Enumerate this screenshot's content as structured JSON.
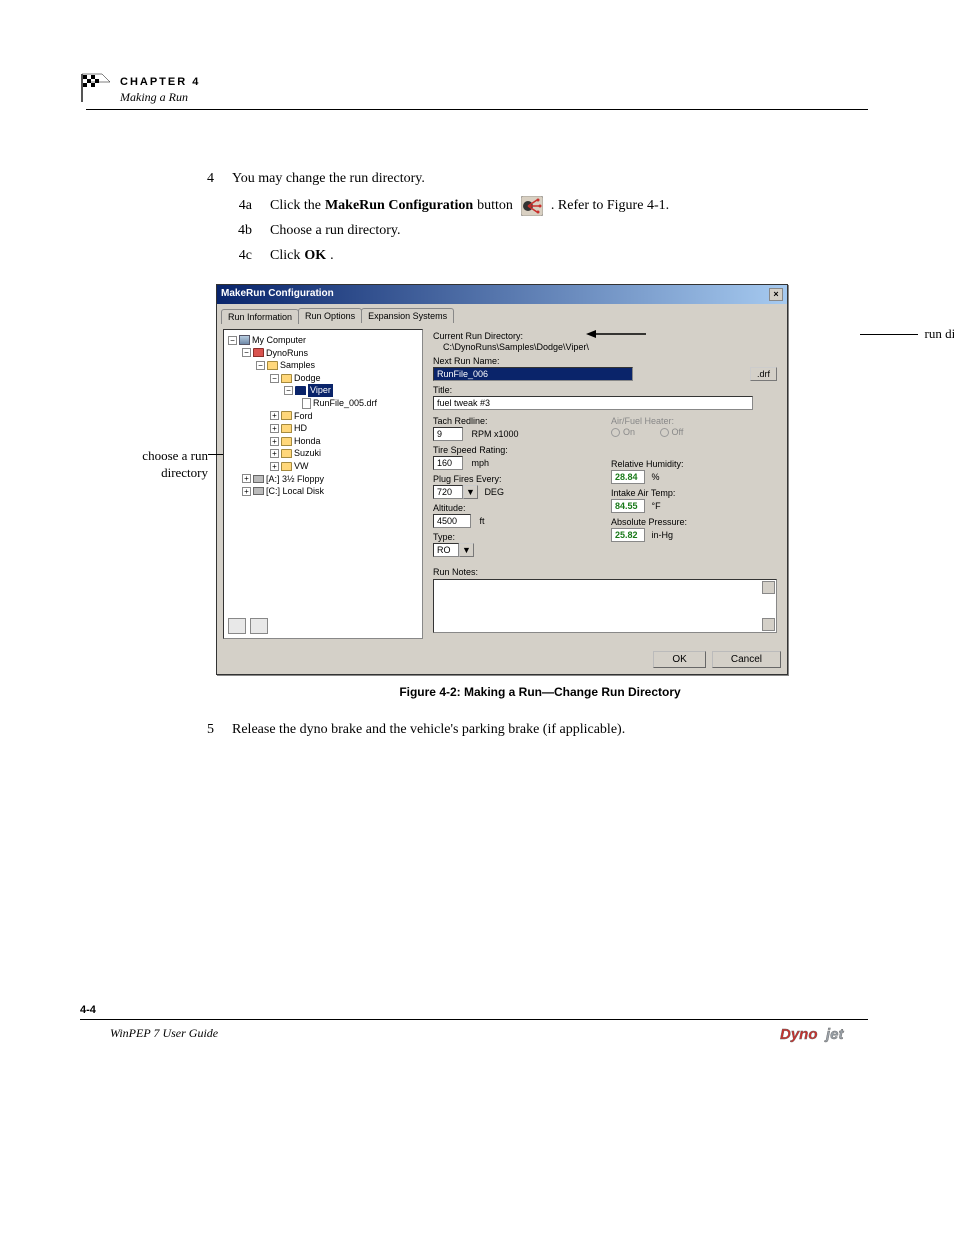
{
  "header": {
    "chapter": "CHAPTER 4",
    "subtitle": "Making a Run"
  },
  "steps": {
    "s4": {
      "num": "4",
      "text": "You may change the run directory."
    },
    "s4a": {
      "num": "4a",
      "pre": "Click the ",
      "bold": "MakeRun Configuration",
      "mid": " button ",
      "post": ". Refer to Figure 4-1."
    },
    "s4b": {
      "num": "4b",
      "text": "Choose a run directory."
    },
    "s4c": {
      "num": "4c",
      "pre": "Click ",
      "bold": "OK",
      "post": "."
    },
    "s5": {
      "num": "5",
      "text": "Release the dyno brake and the vehicle's parking brake (if applicable)."
    }
  },
  "callouts": {
    "left": "choose a run directory",
    "right": "run directory"
  },
  "dialog": {
    "title": "MakeRun Configuration",
    "tabs": {
      "t1": "Run Information",
      "t2": "Run Options",
      "t3": "Expansion Systems"
    },
    "tree": {
      "mycomputer": "My Computer",
      "dynoruns": "DynoRuns",
      "samples": "Samples",
      "dodge": "Dodge",
      "viper": "Viper",
      "runfile": "RunFile_005.drf",
      "ford": "Ford",
      "hd": "HD",
      "honda": "Honda",
      "suzuki": "Suzuki",
      "vw": "VW",
      "floppy": "[A:]  3½ Floppy",
      "localdisk": "[C:]  Local Disk"
    },
    "form": {
      "curdir_label": "Current Run Directory:",
      "curdir": "C:\\DynoRuns\\Samples\\Dodge\\Viper\\",
      "nextname_label": "Next Run Name:",
      "nextname": "RunFile_006",
      "drf_btn": ".drf",
      "title_label": "Title:",
      "title": "fuel tweak #3",
      "tach_label": "Tach Redline:",
      "tach": "9",
      "tach_unit": "RPM x1000",
      "afheater_label": "Air/Fuel Heater:",
      "on": "On",
      "off": "Off",
      "tire_label": "Tire Speed Rating:",
      "tire": "160",
      "tire_unit": "mph",
      "plug_label": "Plug Fires Every:",
      "plug": "720",
      "plug_unit": "DEG",
      "relhum_label": "Relative Humidity:",
      "relhum": "28.84",
      "relhum_unit": "%",
      "alt_label": "Altitude:",
      "alt": "4500",
      "alt_unit": "ft",
      "intake_label": "Intake Air Temp:",
      "intake": "84.55",
      "intake_unit": "°F",
      "type_label": "Type:",
      "type": "RO",
      "abspress_label": "Absolute Pressure:",
      "abspress": "25.82",
      "abspress_unit": "in-Hg",
      "notes_label": "Run Notes:"
    },
    "buttons": {
      "ok": "OK",
      "cancel": "Cancel"
    }
  },
  "figure_caption": "Figure 4-2: Making a Run—Change Run Directory",
  "footer": {
    "page": "4-4",
    "title": "WinPEP 7 User Guide",
    "logo": "Dynojet"
  }
}
